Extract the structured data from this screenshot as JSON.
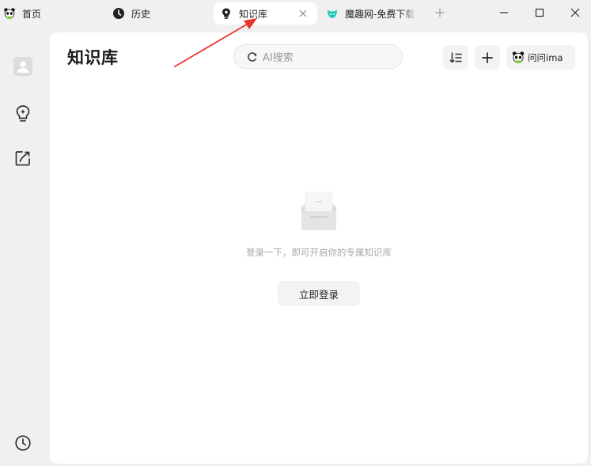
{
  "tabs": [
    {
      "label": "首页",
      "icon": "panda-icon"
    },
    {
      "label": "历史",
      "icon": "clock-icon"
    },
    {
      "label": "知识库",
      "icon": "lightbulb-icon",
      "active": true
    },
    {
      "label": "魔趣网-免费下载",
      "icon": "site-logo-icon"
    }
  ],
  "header": {
    "title": "知识库",
    "search_placeholder": "AI搜索",
    "ask_label": "问问ima"
  },
  "empty_state": {
    "message": "登录一下，即可开启你的专属知识库",
    "login_label": "立即登录"
  },
  "colors": {
    "accent_arrow": "#e8362a",
    "logo_teal": "#1fc9b6",
    "panda_green": "#7ad23c"
  }
}
